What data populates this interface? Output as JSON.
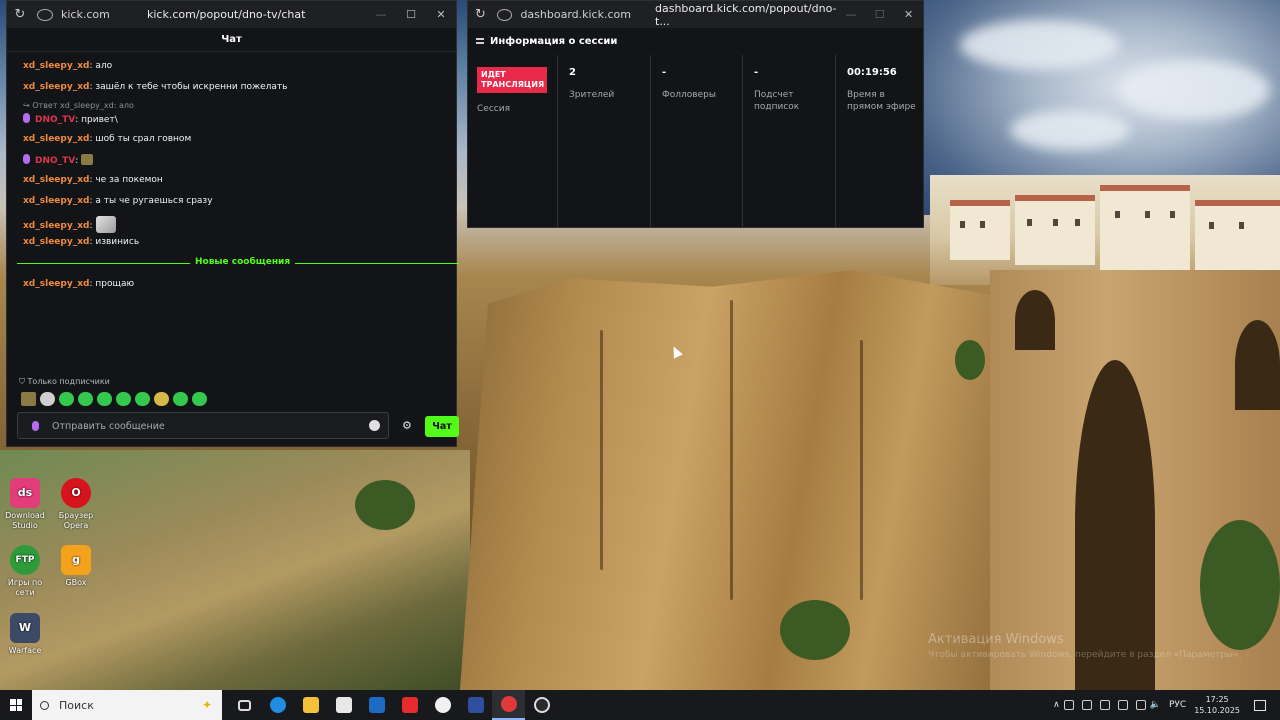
{
  "chat_window": {
    "domain": "kick.com",
    "url": "kick.com/popout/dno-tv/chat",
    "header_title": "Чат",
    "messages": [
      {
        "user": "xd_sleepy_xd",
        "text": ": ало"
      },
      {
        "user": "xd_sleepy_xd",
        "text": ": зашёл к тебе чтобы искренни пожелать"
      },
      {
        "reply_hint": "Ответ xd_sleepy_xd: ало"
      },
      {
        "user": "DNO_TV",
        "text": ": привет\\",
        "streamer": true
      },
      {
        "user": "xd_sleepy_xd",
        "text": ": шоб ты срал говном"
      },
      {
        "user": "DNO_TV",
        "text": ":",
        "streamer": true
      },
      {
        "user": "xd_sleepy_xd",
        "text": ": че за покемон"
      },
      {
        "user": "xd_sleepy_xd",
        "text": ": а ты че ругаешься сразу"
      },
      {
        "user": "xd_sleepy_xd",
        "text": ":"
      },
      {
        "user": "xd_sleepy_xd",
        "text": ": извинись"
      },
      {
        "user": "xd_sleepy_xd",
        "text": ": прощаю"
      }
    ],
    "new_messages_label": "Новые сообщения",
    "subscribers_only_label": "Только подписчики",
    "input_placeholder": "Отправить сообщение",
    "send_button_label": "Чат"
  },
  "dashboard_window": {
    "domain": "dashboard.kick.com",
    "url": "dashboard.kick.com/popout/dno-t...",
    "section_title": "Информация о сессии",
    "live_badge": "ИДЕТ ТРАНСЛЯЦИЯ",
    "session_label": "Сессия",
    "stats": [
      {
        "value": "2",
        "label": "Зрителей"
      },
      {
        "value": "-",
        "label": "Фолловеры"
      },
      {
        "value": "-",
        "label": "Подсчет подписок"
      },
      {
        "value": "00:19:56",
        "label": "Время в прямом эфире"
      }
    ]
  },
  "desktop": {
    "icons": [
      {
        "label": "Download Studio",
        "glyph": "ds",
        "color": "#e33c7a"
      },
      {
        "label": "Браузер Opera",
        "glyph": "O",
        "color": "#d7141e"
      },
      {
        "label": "Игры по сети",
        "glyph": "FTP",
        "color": "#2f9a3a"
      },
      {
        "label": "GBox",
        "glyph": "g",
        "color": "#f4a21b"
      },
      {
        "label": "Warface",
        "glyph": "W",
        "color": "#3c4a66"
      }
    ],
    "activation_title": "Активация Windows",
    "activation_subtitle": "Чтобы активировать Windows, перейдите в раздел «Параметры»."
  },
  "taskbar": {
    "search_placeholder": "Поиск",
    "language": "РУС",
    "time": "17:25",
    "date": "15.10.2025"
  }
}
